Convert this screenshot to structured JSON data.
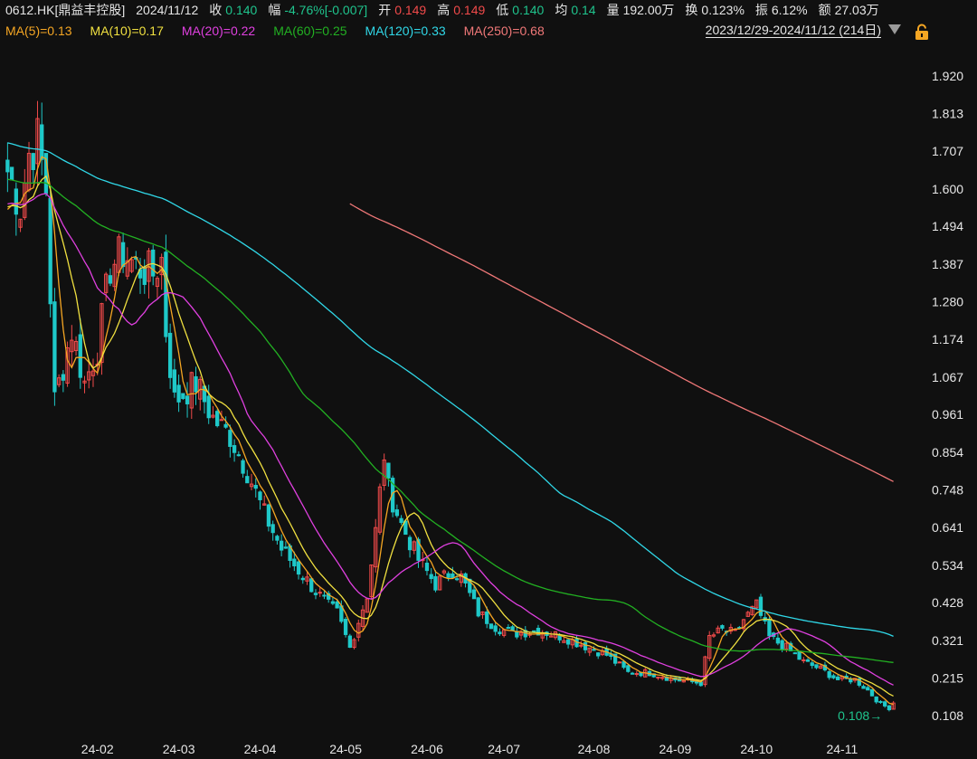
{
  "header": {
    "code": "0612.HK[鼎益丰控股]",
    "date": "2024/11/12",
    "close_label": "收",
    "close": "0.140",
    "change_label": "幅",
    "change": "-4.76%[-0.007]",
    "open_label": "开",
    "open": "0.149",
    "high_label": "高",
    "high": "0.149",
    "low_label": "低",
    "low": "0.140",
    "avg_label": "均",
    "avg": "0.14",
    "volume_label": "量",
    "volume": "192.00万",
    "turnover_label": "换",
    "turnover": "0.123%",
    "amplitude_label": "振",
    "amplitude": "6.12%",
    "amount_label": "额",
    "amount": "27.03万"
  },
  "ma_legend": [
    {
      "text": "MA(5)=0.13",
      "color": "#f5a623"
    },
    {
      "text": "MA(10)=0.17",
      "color": "#f0e040"
    },
    {
      "text": "MA(20)=0.22",
      "color": "#e040e0"
    },
    {
      "text": "MA(60)=0.25",
      "color": "#22b022"
    },
    {
      "text": "MA(120)=0.33",
      "color": "#30d8e8"
    },
    {
      "text": "MA(250)=0.68",
      "color": "#f07878"
    }
  ],
  "date_range": "2023/12/29-2024/11/12 (214日)",
  "icons": {
    "dropdown": "triangle-down-icon",
    "lock": "lock-icon"
  },
  "colors": {
    "up": "#f04a4a",
    "down": "#1fc8c8",
    "background": "#101010",
    "text": "#e6e6e6"
  },
  "chart_data": {
    "type": "candlestick",
    "y_ticks": [
      "1.920",
      "1.813",
      "1.707",
      "1.600",
      "1.494",
      "1.387",
      "1.280",
      "1.174",
      "1.067",
      "0.961",
      "0.854",
      "0.748",
      "0.641",
      "0.534",
      "0.428",
      "0.321",
      "0.215",
      "0.108"
    ],
    "ylim": [
      0.06,
      1.99
    ],
    "x_ticks": [
      {
        "label": "24-02",
        "index": 21
      },
      {
        "label": "24-03",
        "index": 40
      },
      {
        "label": "24-04",
        "index": 59
      },
      {
        "label": "24-05",
        "index": 79
      },
      {
        "label": "24-06",
        "index": 98
      },
      {
        "label": "24-07",
        "index": 116
      },
      {
        "label": "24-08",
        "index": 137
      },
      {
        "label": "24-09",
        "index": 156
      },
      {
        "label": "24-10",
        "index": 175
      },
      {
        "label": "24-11",
        "index": 195
      }
    ],
    "price_anchors": [
      [
        0,
        1.65
      ],
      [
        3,
        1.55
      ],
      [
        5,
        1.7
      ],
      [
        7,
        1.74
      ],
      [
        9,
        1.6
      ],
      [
        11,
        1.0
      ],
      [
        13,
        1.1
      ],
      [
        15,
        1.2
      ],
      [
        18,
        1.05
      ],
      [
        21,
        1.15
      ],
      [
        24,
        1.38
      ],
      [
        27,
        1.42
      ],
      [
        30,
        1.38
      ],
      [
        34,
        1.36
      ],
      [
        36,
        1.4
      ],
      [
        37,
        1.2
      ],
      [
        39,
        1.0
      ],
      [
        44,
        1.05
      ],
      [
        48,
        0.95
      ],
      [
        52,
        0.9
      ],
      [
        56,
        0.8
      ],
      [
        60,
        0.68
      ],
      [
        64,
        0.58
      ],
      [
        68,
        0.52
      ],
      [
        72,
        0.46
      ],
      [
        75,
        0.42
      ],
      [
        77,
        0.4
      ],
      [
        80,
        0.3
      ],
      [
        84,
        0.45
      ],
      [
        86,
        0.63
      ],
      [
        88,
        0.85
      ],
      [
        89,
        0.75
      ],
      [
        92,
        0.65
      ],
      [
        96,
        0.55
      ],
      [
        100,
        0.48
      ],
      [
        104,
        0.52
      ],
      [
        106,
        0.5
      ],
      [
        110,
        0.4
      ],
      [
        114,
        0.36
      ],
      [
        118,
        0.34
      ],
      [
        124,
        0.35
      ],
      [
        130,
        0.33
      ],
      [
        136,
        0.3
      ],
      [
        140,
        0.28
      ],
      [
        145,
        0.23
      ],
      [
        150,
        0.23
      ],
      [
        156,
        0.21
      ],
      [
        162,
        0.2
      ],
      [
        164,
        0.33
      ],
      [
        167,
        0.35
      ],
      [
        170,
        0.34
      ],
      [
        172,
        0.38
      ],
      [
        175,
        0.42
      ],
      [
        178,
        0.33
      ],
      [
        182,
        0.3
      ],
      [
        186,
        0.26
      ],
      [
        190,
        0.24
      ],
      [
        194,
        0.21
      ],
      [
        198,
        0.21
      ],
      [
        201,
        0.18
      ],
      [
        204,
        0.14
      ],
      [
        206,
        0.13
      ],
      [
        207,
        0.145
      ]
    ],
    "total_candles": 214,
    "moving_averages": [
      {
        "name": "MA(5)",
        "period": 5,
        "color": "#f5a623"
      },
      {
        "name": "MA(10)",
        "period": 10,
        "color": "#f0e040"
      },
      {
        "name": "MA(20)",
        "period": 20,
        "color": "#e040e0"
      },
      {
        "name": "MA(60)",
        "period": 60,
        "color": "#22b022"
      },
      {
        "name": "MA(120)",
        "period": 120,
        "color": "#30d8e8"
      },
      {
        "name": "MA(250)",
        "period": 250,
        "color": "#f07878"
      }
    ],
    "low_annotation": {
      "text": "0.108",
      "index": 205,
      "value": 0.108
    }
  }
}
